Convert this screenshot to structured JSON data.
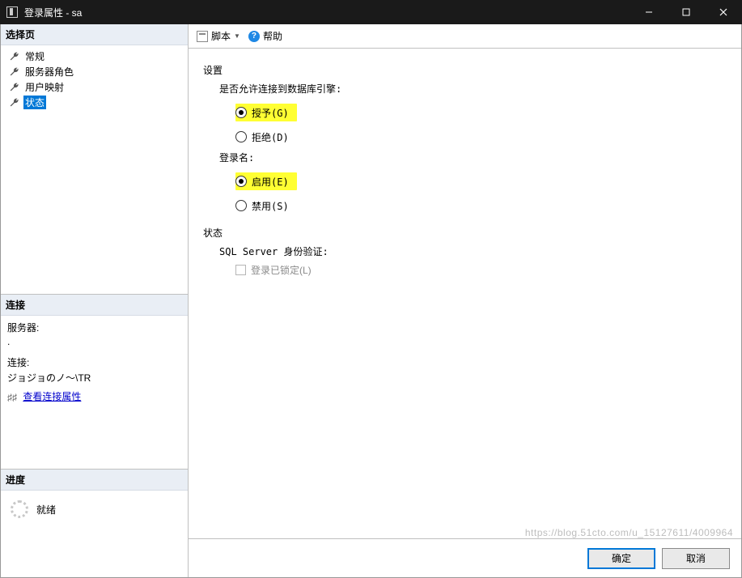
{
  "window": {
    "title": "登录属性 - sa"
  },
  "left": {
    "select_page_header": "选择页",
    "nav": [
      {
        "label": "常规"
      },
      {
        "label": "服务器角色"
      },
      {
        "label": "用户映射"
      },
      {
        "label": "状态"
      }
    ],
    "connection": {
      "header": "连接",
      "server_label": "服务器:",
      "server_value": ".",
      "conn_label": "连接:",
      "conn_value": "ジョジョのノ〜\\TR",
      "view_props": "查看连接属性"
    },
    "progress": {
      "header": "进度",
      "status": "就绪"
    }
  },
  "toolbar": {
    "script": "脚本",
    "help": "帮助"
  },
  "content": {
    "settings_header": "设置",
    "perm_label": "是否允许连接到数据库引擎:",
    "perm_grant": "授予(G)",
    "perm_deny": "拒绝(D)",
    "login_label": "登录名:",
    "login_enable": "启用(E)",
    "login_disable": "禁用(S)",
    "status_header": "状态",
    "sql_auth_label": "SQL Server 身份验证:",
    "locked_label": "登录已锁定(L)"
  },
  "buttons": {
    "ok": "确定",
    "cancel": "取消"
  },
  "watermark": "https://blog.51cto.com/u_15127611/4009964"
}
